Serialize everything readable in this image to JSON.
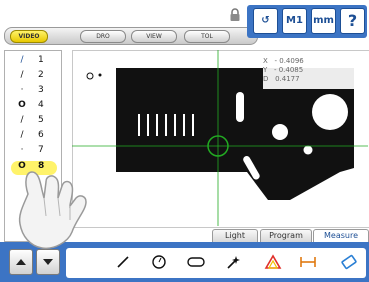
{
  "header": {
    "tabs": [
      {
        "label": "VIDEO",
        "active": true
      },
      {
        "label": "DRO",
        "active": false
      },
      {
        "label": "VIEW",
        "active": false
      },
      {
        "label": "TOL",
        "active": false
      }
    ],
    "icons": [
      {
        "name": "undo-icon",
        "label": "↺"
      },
      {
        "name": "m1-button",
        "label": "M1"
      },
      {
        "name": "units-button",
        "label": "mm"
      },
      {
        "name": "help-icon",
        "label": "?"
      }
    ]
  },
  "feature_list": {
    "items": [
      {
        "num": "1",
        "type": "line"
      },
      {
        "num": "2",
        "type": "line"
      },
      {
        "num": "3",
        "type": "point"
      },
      {
        "num": "4",
        "type": "circle"
      },
      {
        "num": "5",
        "type": "line"
      },
      {
        "num": "6",
        "type": "line"
      },
      {
        "num": "7",
        "type": "point"
      },
      {
        "num": "8",
        "type": "circle",
        "selected": true
      }
    ]
  },
  "readout": {
    "x_label": "X",
    "x_value": "- 0.4096",
    "y_label": "Y",
    "y_value": "- 0.4085",
    "d_label": "D",
    "d_value": "0.4177"
  },
  "bottom_tabs": [
    {
      "label": "Light",
      "active": false
    },
    {
      "label": "Program",
      "active": false
    },
    {
      "label": "Measure",
      "active": true
    }
  ],
  "colors": {
    "accent_blue": "#3c74c4",
    "selected_yellow": "#fff36a",
    "crosshair_green": "#22aa22",
    "part_black": "#111111"
  }
}
